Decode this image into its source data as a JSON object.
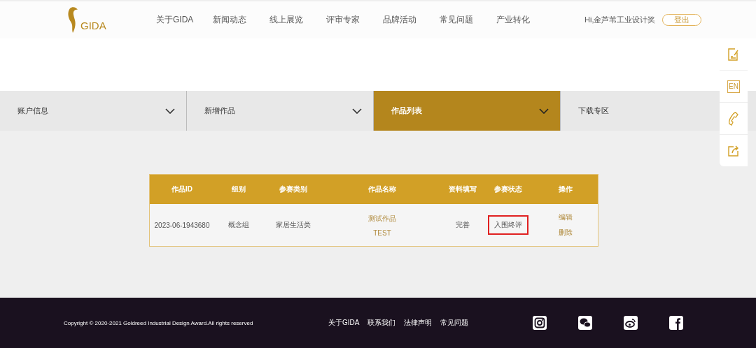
{
  "header": {
    "logo": "GIDA",
    "nav": [
      "关于GIDA",
      "新闻动态",
      "线上展览",
      "评审专家",
      "品牌活动",
      "常见问题",
      "产业转化"
    ],
    "greeting": "Hi,金芦苇工业设计奖",
    "logout": "登出"
  },
  "tabs": [
    {
      "label": "账户信息",
      "selected": false
    },
    {
      "label": "新增作品",
      "selected": false
    },
    {
      "label": "作品列表",
      "selected": true
    },
    {
      "label": "下载专区",
      "selected": false
    }
  ],
  "table": {
    "columns": [
      "作品ID",
      "组别",
      "参赛类别",
      "作品名称",
      "资料填写",
      "参赛状态",
      "操作"
    ],
    "rows": [
      {
        "id": "2023-06-1943680",
        "group": "概念组",
        "category": "家居生活类",
        "name": [
          "测试作品",
          "TEST"
        ],
        "info": "完善",
        "status": "入围终评",
        "status_highlighted": true,
        "actions": [
          "编辑",
          "删除"
        ]
      }
    ]
  },
  "side_rail": {
    "language": "EN"
  },
  "footer": {
    "copyright": "Copyright © 2020-2021 Goldreed Industrial Design Award.All rights reserved",
    "links": [
      "关于GIDA",
      "联系我们",
      "法律声明",
      "常见问题"
    ]
  }
}
